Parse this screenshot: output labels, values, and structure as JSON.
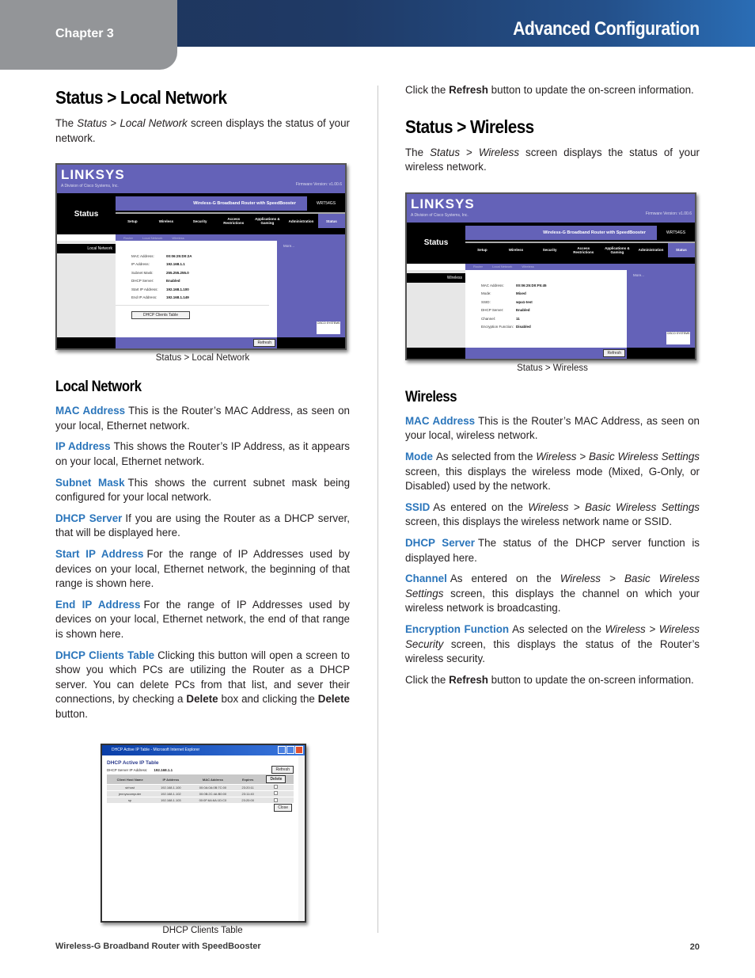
{
  "header": {
    "chapter": "Chapter 3",
    "title": "Advanced Configuration"
  },
  "left": {
    "title": "Status > Local Network",
    "intro": {
      "pre": "The ",
      "em1": "Status",
      "mid": " > ",
      "em2": "Local Network",
      "post": " screen displays the status of your network."
    },
    "screenshot": {
      "logo": "LINKSYS",
      "logo_sub": "A Division of Cisco Systems, Inc.",
      "firmware": "Firmware Version: v1.00.6",
      "section": "Status",
      "product": "Wireless-G Broadband Router with SpeedBooster",
      "model": "WRT54GS",
      "tabs": [
        "Setup",
        "Wireless",
        "Security",
        "Access Restrictions",
        "Applications & Gaming",
        "Administration",
        "Status"
      ],
      "subtabs": [
        "Router",
        "Local Network",
        "Wireless"
      ],
      "side_label": "Local Network",
      "fields": [
        {
          "k": "MAC Address:",
          "v": "00:06:25:D0:2A"
        },
        {
          "k": "IP Address:",
          "v": "192.168.1.1"
        },
        {
          "k": "Subnet Mask:",
          "v": "255.255.255.0"
        },
        {
          "k": "DHCP Server:",
          "v": "Enabled"
        },
        {
          "k": "Start IP Address:",
          "v": "192.168.1.100"
        },
        {
          "k": "End IP Address:",
          "v": "192.168.1.149"
        }
      ],
      "dhcp_button": "DHCP Clients Table",
      "more": "More...",
      "refresh": "Refresh",
      "cisco": "CISCO SYSTEMS"
    },
    "caption": "Status > Local Network",
    "subheading": "Local Network",
    "items": [
      {
        "term": "MAC Address",
        "text": "This is the Router’s MAC Address, as seen on your local, Ethernet network."
      },
      {
        "term": "IP Address",
        "text": "This shows the Router’s IP Address, as it appears on your local, Ethernet network."
      },
      {
        "term": "Subnet Mask",
        "text": "This shows the current subnet mask being configured for your local network."
      },
      {
        "term": "DHCP Server",
        "text": "If you are using the Router as a DHCP server, that will be displayed here."
      },
      {
        "term": "Start IP Address",
        "text": "For the range of IP Addresses used by devices on your local, Ethernet network, the beginning of that range is shown here."
      },
      {
        "term": "End IP Address",
        "text": "For the range of IP Addresses used by devices on your local, Ethernet network, the end of that range is shown here."
      }
    ],
    "dhcp_item": {
      "term": "DHCP Clients Table",
      "text1": "Clicking this button will open a screen to show you which PCs are utilizing the Router as a DHCP server. You can delete PCs from that list, and sever their connections, by checking a ",
      "bold1": "Delete",
      "text2": " box and clicking the ",
      "bold2": "Delete",
      "text3": " button."
    },
    "dhcp_window": {
      "title": "DHCP Active IP Table - Microsoft Internet Explorer",
      "heading": "DHCP Active IP Table",
      "server_label": "DHCP Server IP Address:",
      "server_value": "192.168.1.1",
      "refresh": "Refresh",
      "delete": "Delete",
      "close": "Close",
      "columns": [
        "Client Host Name",
        "IP Address",
        "MAC Address",
        "Expires"
      ],
      "rows": [
        [
          "sirhost",
          "192.168.1.100",
          "00:0A:0A:0B:7C:00",
          "23:20:11"
        ],
        [
          "jennyscomputer",
          "192.168.1.102",
          "00:0B:2C:4A:B0:00",
          "23:11:40"
        ],
        [
          "sp",
          "192.168.1.103",
          "00:0F:6A:6A:1D:C0",
          "23:20:00"
        ]
      ]
    },
    "dhcp_caption": "DHCP Clients Table"
  },
  "right": {
    "refresh_note": {
      "pre": "Click the ",
      "bold": "Refresh",
      "post": " button to update the on-screen information."
    },
    "title": "Status > Wireless",
    "intro": {
      "pre": "The ",
      "em1": "Status",
      "mid": " > ",
      "em2": "Wireless",
      "post": " screen displays the status of your wireless network."
    },
    "screenshot": {
      "logo": "LINKSYS",
      "logo_sub": "A Division of Cisco Systems, Inc.",
      "firmware": "Firmware Version: v1.00.6",
      "section": "Status",
      "product": "Wireless-G Broadband Router with SpeedBooster",
      "model": "WRT54GS",
      "tabs": [
        "Setup",
        "Wireless",
        "Security",
        "Access Restrictions",
        "Applications & Gaming",
        "Administration",
        "Status"
      ],
      "subtabs": [
        "Router",
        "Local Network",
        "Wireless"
      ],
      "side_label": "Wireless",
      "fields": [
        {
          "k": "MAC Address:",
          "v": "00:06:25:D0:F5:45"
        },
        {
          "k": "Mode:",
          "v": "Mixed"
        },
        {
          "k": "SSID:",
          "v": "wpa1-test"
        },
        {
          "k": "DHCP Server:",
          "v": "Enabled"
        },
        {
          "k": "Channel:",
          "v": "11"
        },
        {
          "k": "Encryption Function:",
          "v": "Disabled"
        }
      ],
      "more": "More...",
      "refresh": "Refresh",
      "cisco": "CISCO SYSTEMS"
    },
    "caption": "Status > Wireless",
    "subheading": "Wireless",
    "items": [
      {
        "term": "MAC Address",
        "parts": [
          {
            "t": "This is the Router’s MAC Address, as seen on your local, wireless network."
          }
        ]
      },
      {
        "term": "Mode",
        "parts": [
          {
            "t": "As selected from the "
          },
          {
            "em": "Wireless > Basic Wireless Settings"
          },
          {
            "t": " screen, this displays the wireless mode (Mixed, G-Only, or Disabled) used by the network."
          }
        ]
      },
      {
        "term": "SSID",
        "parts": [
          {
            "t": "As entered on the "
          },
          {
            "em": "Wireless > Basic Wireless Settings"
          },
          {
            "t": " screen, this displays the wireless network name or SSID."
          }
        ]
      },
      {
        "term": "DHCP Server",
        "parts": [
          {
            "t": "The status of the DHCP server function is displayed here."
          }
        ]
      },
      {
        "term": "Channel",
        "parts": [
          {
            "t": "As entered on the "
          },
          {
            "em": "Wireless > Basic Wireless Settings"
          },
          {
            "t": " screen, this displays the channel on which your wireless network is broadcasting."
          }
        ]
      },
      {
        "term": "Encryption Function",
        "parts": [
          {
            "t": "As selected on the "
          },
          {
            "em": "Wireless > Wireless Security"
          },
          {
            "t": " screen, this displays the status of the Router’s wireless security."
          }
        ]
      }
    ],
    "refresh_note2": {
      "pre": "Click the ",
      "bold": "Refresh",
      "post": " button to update the on-screen information."
    }
  },
  "footer": {
    "product": "Wireless-G Broadband Router with SpeedBooster",
    "page": "20"
  },
  "colors": {
    "term_blue": "#2a75bb",
    "header_dark": "#1e3358",
    "chapter_gray": "#939598",
    "router_purple": "#6462b8"
  }
}
